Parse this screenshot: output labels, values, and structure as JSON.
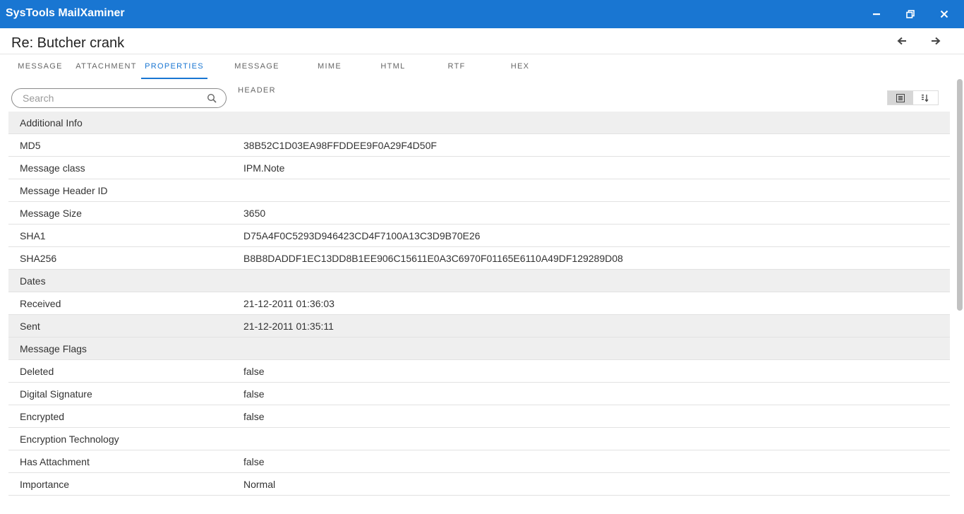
{
  "app": {
    "title": "SysTools MailXaminer"
  },
  "window_controls": {
    "minimize_icon": "minimize-icon",
    "restore_icon": "restore-icon",
    "close_icon": "close-icon"
  },
  "message": {
    "subject": "Re: Butcher crank"
  },
  "tabs": [
    {
      "label": "MESSAGE",
      "active": false
    },
    {
      "label": "ATTACHMENT",
      "active": false
    },
    {
      "label": "PROPERTIES",
      "active": true
    },
    {
      "label": "MESSAGE HEADER",
      "active": false
    },
    {
      "label": "MIME",
      "active": false
    },
    {
      "label": "HTML",
      "active": false
    },
    {
      "label": "RTF",
      "active": false
    },
    {
      "label": "HEX",
      "active": false
    }
  ],
  "search": {
    "placeholder": "Search",
    "value": ""
  },
  "properties": {
    "groups": [
      {
        "title": "Additional Info",
        "rows": [
          {
            "name": "MD5",
            "value": "38B52C1D03EA98FFDDEE9F0A29F4D50F"
          },
          {
            "name": "Message class",
            "value": "IPM.Note"
          },
          {
            "name": "Message Header ID",
            "value": ""
          },
          {
            "name": "Message Size",
            "value": "3650"
          },
          {
            "name": "SHA1",
            "value": "D75A4F0C5293D946423CD4F7100A13C3D9B70E26"
          },
          {
            "name": "SHA256",
            "value": "B8B8DADDF1EC13DD8B1EE906C15611E0A3C6970F01165E6110A49DF129289D08"
          }
        ]
      },
      {
        "title": "Dates",
        "rows": [
          {
            "name": "Received",
            "value": "21-12-2011 01:36:03"
          },
          {
            "name": "Sent",
            "value": "21-12-2011 01:35:11"
          }
        ]
      },
      {
        "title": "Message Flags",
        "rows": [
          {
            "name": "Deleted",
            "value": "false"
          },
          {
            "name": "Digital Signature",
            "value": "false"
          },
          {
            "name": "Encrypted",
            "value": "false"
          },
          {
            "name": "Encryption Technology",
            "value": ""
          },
          {
            "name": "Has Attachment",
            "value": "false"
          },
          {
            "name": "Importance",
            "value": "Normal"
          }
        ]
      }
    ]
  },
  "colors": {
    "accent": "#1976d2",
    "group_background": "#efefef",
    "row_border": "#e2e2e2"
  }
}
